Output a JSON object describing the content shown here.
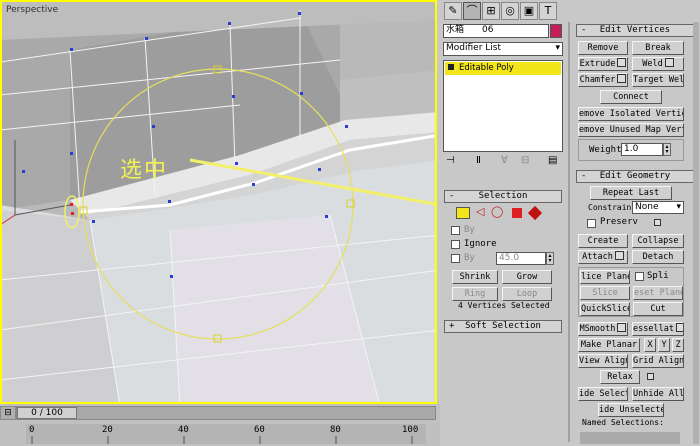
{
  "viewport": {
    "label": "Perspective",
    "annotation": "选中"
  },
  "toolbar_icons": [
    "create-icon",
    "modify-icon",
    "hierarchy-icon",
    "motion-icon",
    "display-icon",
    "utilities-icon"
  ],
  "object": {
    "name": "水箱",
    "number": "06",
    "color": "#c21f5a"
  },
  "modifier": {
    "list_label": "Modifier List",
    "stack_item": "Editable Poly"
  },
  "stack_buttons": [
    "pin-stack-icon",
    "show-end-result-icon",
    "make-unique-icon",
    "remove-modifier-icon",
    "configure-sets-icon"
  ],
  "selection": {
    "title": "Selection",
    "by_vertex": "By",
    "ignore": "Ignore",
    "by_angle": "By",
    "angle_value": "45.0",
    "shrink": "Shrink",
    "grow": "Grow",
    "ring": "Ring",
    "loop": "Loop",
    "status": "4 Vertices Selected"
  },
  "edit_vertices": {
    "title": "Edit Vertices",
    "remove": "Remove",
    "break": "Break",
    "extrude": "Extrude",
    "weld": "Weld",
    "chamfer": "Chamfer",
    "target_weld": "Target Weld",
    "connect": "Connect",
    "remove_isolated": "emove Isolated Vertice",
    "remove_unused": "emove Unused Map Verti",
    "weight_label": "Weight:",
    "weight_value": "1.0"
  },
  "edit_geometry": {
    "title": "Edit Geometry",
    "repeat_last": "Repeat Last",
    "constraints_label": "Constraints:",
    "constraints_value": "None",
    "preserve": "Preserv",
    "create": "Create",
    "collapse": "Collapse",
    "attach": "Attach",
    "detach": "Detach",
    "slice_plane": "lice Plane",
    "split": "Spli",
    "slice": "Slice",
    "reset_plane": "eset Plane",
    "quickslice": "QuickSlice",
    "cut": "Cut",
    "msmooth": "MSmooth",
    "tessellate": "essellat",
    "make_planar": "Make Planar",
    "x": "X",
    "y": "Y",
    "z": "Z",
    "view_align": "View Align",
    "grid_align": "Grid Align",
    "relax": "Relax",
    "hide_selected": "ide Selecte",
    "unhide_all": "Unhide All",
    "hide_unselected": "ide Unselecte",
    "named_selections": "Named Selections:"
  },
  "timeline": {
    "frame": "0 / 100",
    "ticks": [
      "0",
      "20",
      "40",
      "60",
      "80",
      "100"
    ]
  },
  "colors": {
    "viewport_border": "#ffff00",
    "selected_vertex": "#e02020",
    "vertex": "#2a3bd6",
    "annotation": "#f2f06a"
  }
}
